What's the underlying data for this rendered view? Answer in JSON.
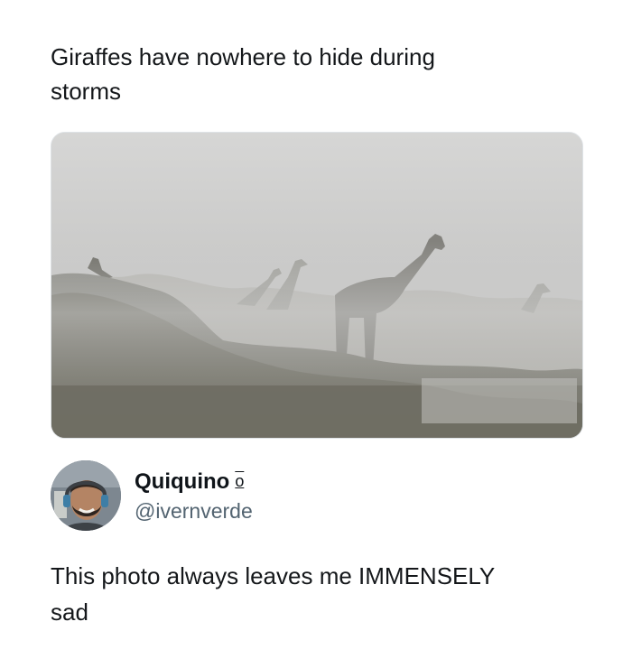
{
  "post": {
    "text_line1": "Giraffes have nowhere to hide during",
    "text_line2": "storms",
    "media_icon": "photo-giraffes-in-fog"
  },
  "reply": {
    "display_name": "Quiquino",
    "name_badge": "o",
    "handle": "@ivernverde",
    "avatar_icon": "avatar-smiling-man-headset",
    "text_line1": "This photo always leaves me IMMENSELY",
    "text_line2": "sad"
  },
  "colors": {
    "text": "#14171a",
    "secondary_text": "#536471",
    "background": "#ffffff",
    "fog": "#c9c9c8"
  }
}
